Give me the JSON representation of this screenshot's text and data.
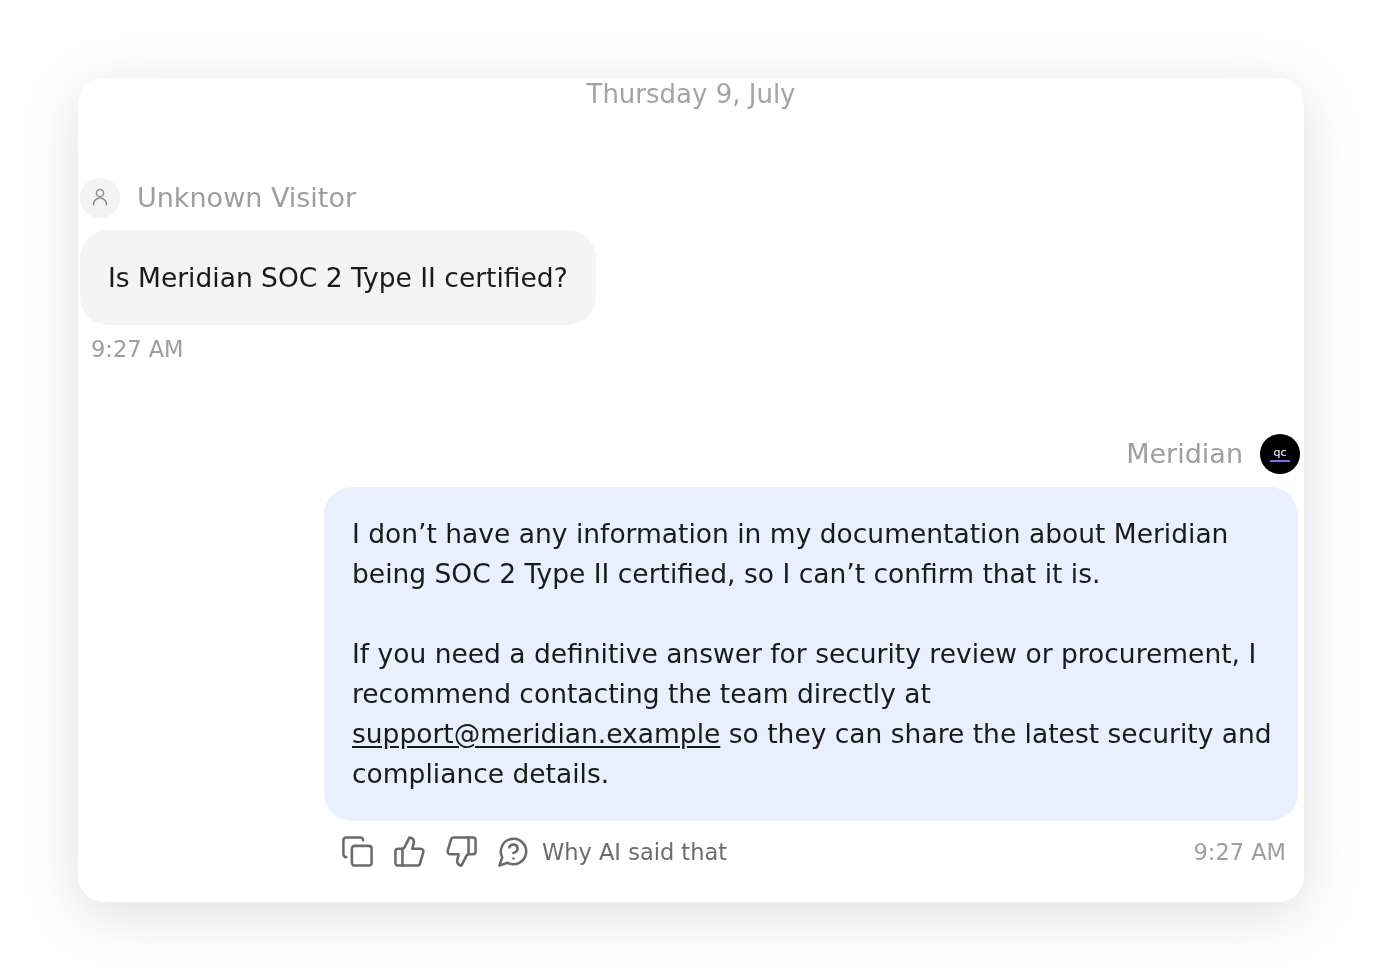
{
  "date_divider": "Thursday 9, July",
  "messages": [
    {
      "kind": "visitor",
      "sender": "Unknown Visitor",
      "paragraphs": [
        [
          {
            "kind": "text",
            "text": "Is Meridian SOC 2 Type II certified?"
          }
        ]
      ],
      "time": "9:27 AM"
    },
    {
      "kind": "agent",
      "sender": "Meridian",
      "logo_text": "qc",
      "paragraphs": [
        [
          {
            "kind": "text",
            "text": "I don’t have any information in my documentation about Meridian being SOC 2 Type II certified, so I can’t confirm that it is."
          }
        ],
        [
          {
            "kind": "text",
            "text": "If you need a definitive answer for security review or procurement, I recommend contacting the team directly at "
          },
          {
            "kind": "link",
            "text": "support@meridian.example"
          },
          {
            "kind": "text",
            "text": " so they can share the latest security and compliance details."
          }
        ]
      ],
      "actions": [
        {
          "kind": "copy"
        },
        {
          "kind": "like"
        },
        {
          "kind": "dislike"
        },
        {
          "kind": "explain",
          "label": "Why AI said that"
        }
      ],
      "time": "9:27 AM"
    }
  ]
}
